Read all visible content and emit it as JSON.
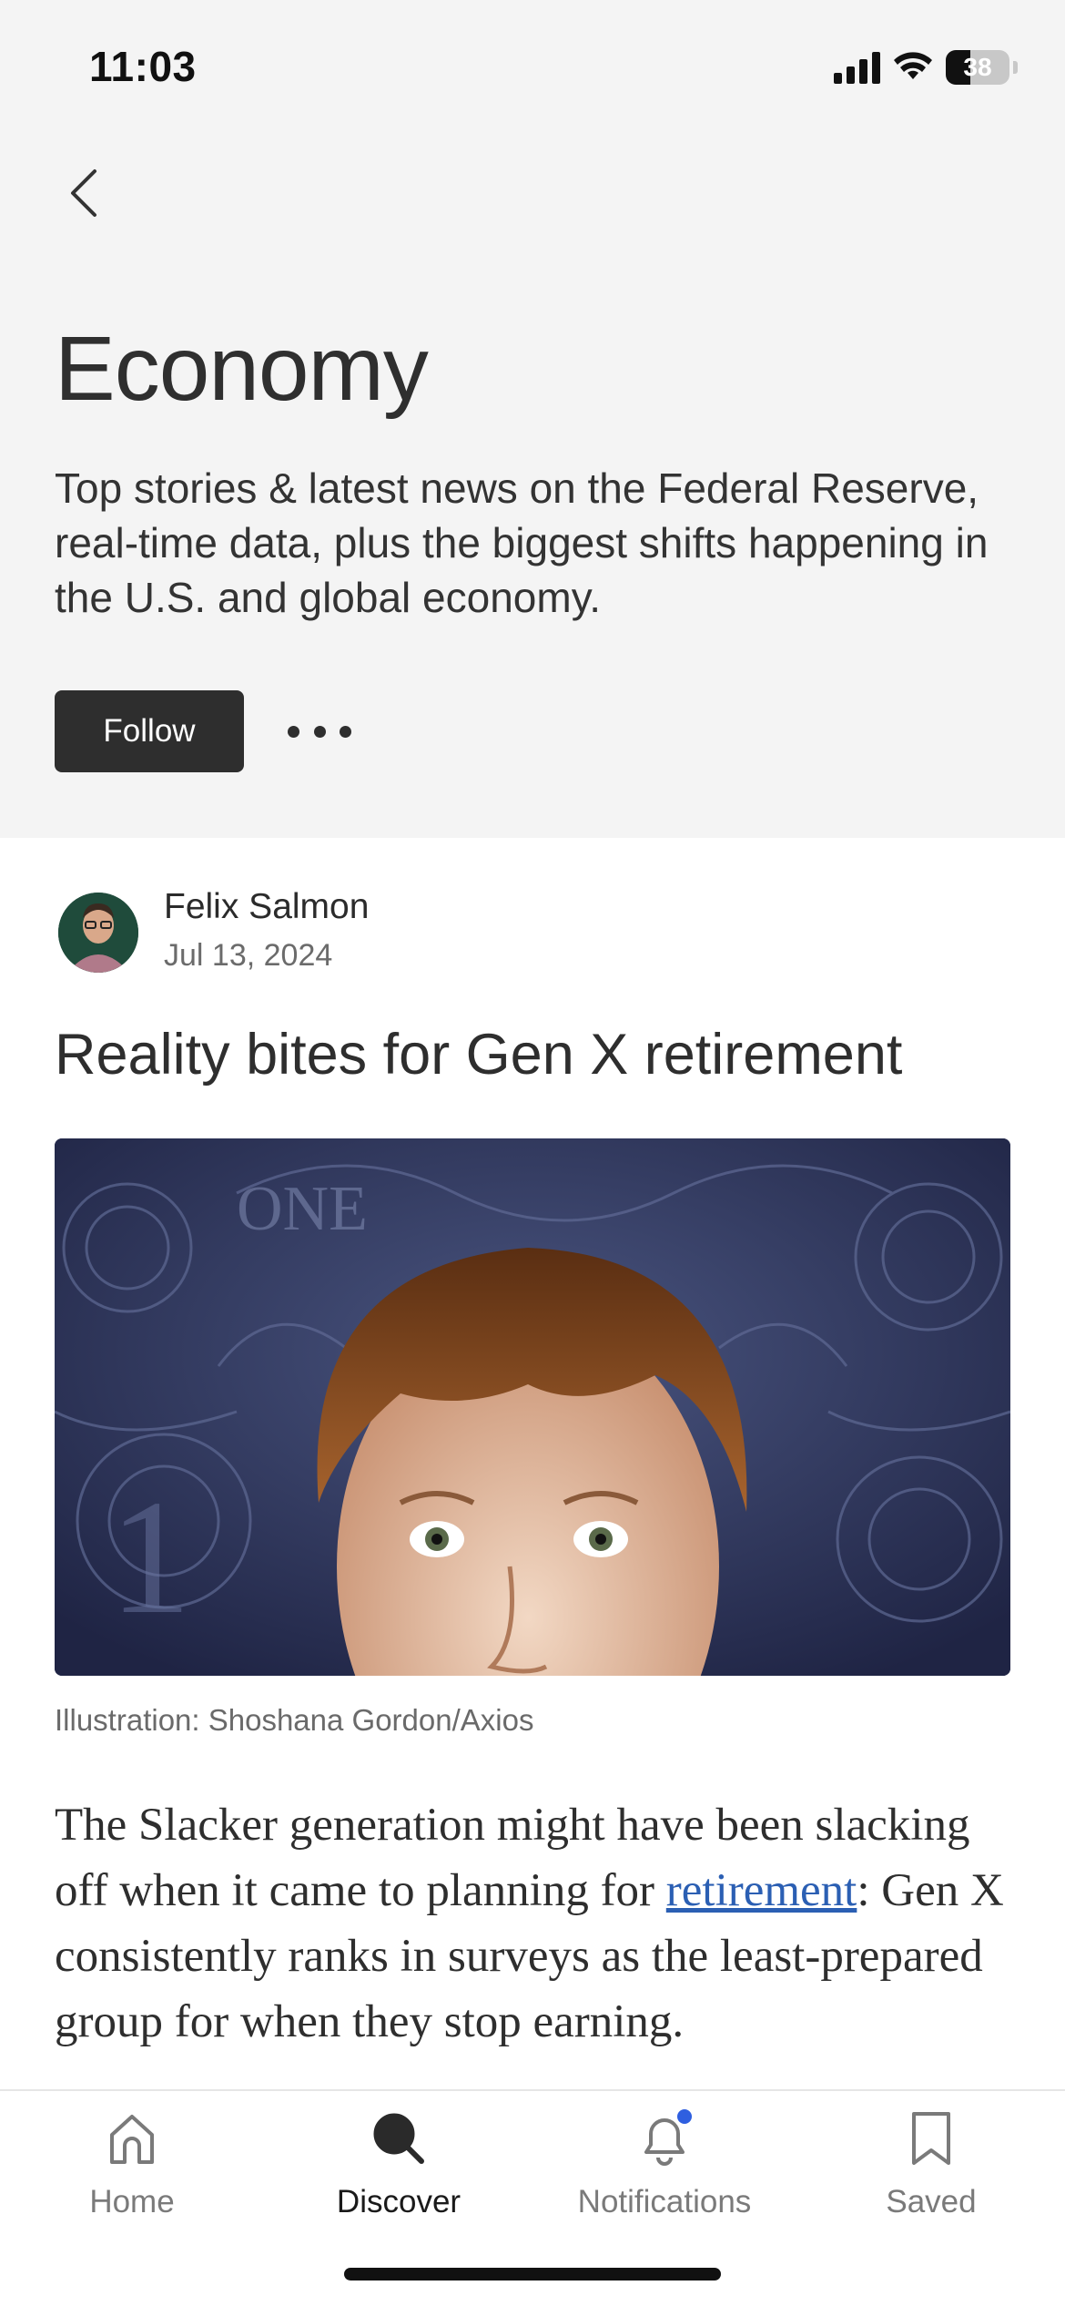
{
  "status_bar": {
    "time": "11:03",
    "battery": "38",
    "battery_level": 0.38
  },
  "topic": {
    "title": "Economy",
    "description": "Top stories & latest news on the Federal Reserve, real-time data, plus the biggest shifts happening in the U.S. and global economy.",
    "follow_label": "Follow"
  },
  "article": {
    "author": "Felix Salmon",
    "date": "Jul 13, 2024",
    "headline": "Reality bites for Gen X retirement",
    "caption": "Illustration: Shoshana Gordon/Axios",
    "body_before_link": "The Slacker generation might have been slacking off when it came to planning for ",
    "body_link": "retirement",
    "body_after_link": ": Gen X consistently ranks in surveys as the least-prepared group for when they stop earning."
  },
  "tabbar": {
    "home": "Home",
    "discover": "Discover",
    "notifications": "Notifications",
    "saved": "Saved"
  },
  "icons": {
    "back": "chevron-left-icon",
    "more": "more-horizontal-icon",
    "home": "home-icon",
    "discover": "search-icon",
    "notifications": "bell-icon",
    "saved": "bookmark-icon"
  },
  "colors": {
    "header_bg": "#f4f4f4",
    "button_bg": "#2e2e2e",
    "link": "#2b5fb3",
    "notification_dot": "#2f5fe0"
  }
}
